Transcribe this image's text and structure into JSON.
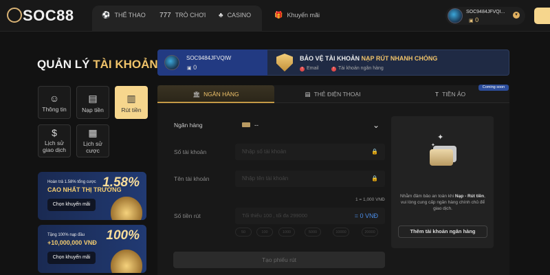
{
  "brand": {
    "logo": "SOC88"
  },
  "nav": {
    "sports": "THỂ THAO",
    "games": "TRÒ CHƠI",
    "casino": "CASINO",
    "promo": "Khuyến mãi"
  },
  "user": {
    "name": "SOC9484JFVQI...",
    "balance": "0"
  },
  "page": {
    "title_a": "QUẢN LÝ",
    "title_b": "TÀI KHOẢN"
  },
  "menu": [
    {
      "label": "Thông tin",
      "icon": "user-icon"
    },
    {
      "label": "Nạp tiền",
      "icon": "deposit-icon"
    },
    {
      "label": "Rút tiền",
      "icon": "withdraw-icon",
      "active": true
    },
    {
      "label": "Lịch sử giao dịch",
      "icon": "history-transaction-icon"
    },
    {
      "label": "Lịch sử cược",
      "icon": "history-bet-icon"
    }
  ],
  "promos": [
    {
      "line1": "Hoàn trả 1.58% tổng cược",
      "line2": "CAO NHẤT THỊ TRƯỜNG",
      "pct": "1.58%",
      "button": "Chọn khuyến mãi"
    },
    {
      "line1": "Tặng 100% nạp đầu",
      "line2": "+10,000,000 VNĐ",
      "pct": "100%",
      "button": "Chọn khuyến mãi"
    }
  ],
  "account": {
    "id": "SOC9484JFVQIW",
    "balance": "0",
    "protect_a": "BẢO VỆ TÀI KHOẢN",
    "protect_b": "NẠP RÚT NHANH CHÓNG",
    "email": "Email",
    "bank": "Tài khoản ngân hàng"
  },
  "tabs": {
    "bank": "NGÂN HÀNG",
    "phone": "THẺ ĐIỆN THOẠI",
    "crypto": "TIỀN ẢO",
    "soon": "Coming soon"
  },
  "form": {
    "bank_label": "Ngân hàng",
    "bank_value": "--",
    "acct_label": "Số tài khoản",
    "acct_placeholder": "Nhập số tài khoản",
    "name_label": "Tên tài khoản",
    "name_placeholder": "Nhập tên tài khoản",
    "rate": "1 = 1,000 VNĐ",
    "amount_label": "Số tiền rút",
    "amount_placeholder": "Tối thiểu 100 , tối đa 299000",
    "amount_value": "= 0 VNĐ",
    "chips": [
      "50",
      "100",
      "1000",
      "5000",
      "10000",
      "20000"
    ],
    "submit": "Tạo phiếu rút"
  },
  "side": {
    "text_a": "Nhằm đảm bảo an toàn khi ",
    "text_b": "Nạp - Rút tiền",
    "text_c": ", vui lòng cung cấp ngân hàng chính chủ để giao dịch.",
    "button": "Thêm tài khoản ngân hàng"
  }
}
